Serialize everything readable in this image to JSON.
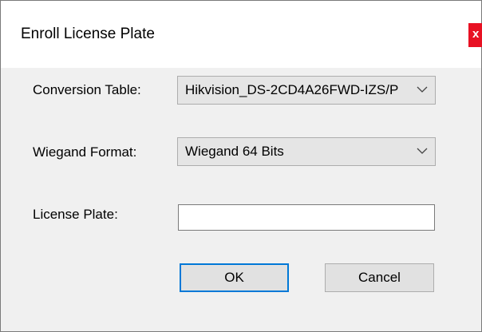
{
  "window": {
    "title": "Enroll License Plate",
    "close_glyph": "x",
    "close_icon": "close-icon"
  },
  "form": {
    "conversion_table": {
      "label": "Conversion Table:",
      "selected_value": "Hikvision_DS-2CD4A26FWD-IZS/P",
      "dropdown_icon": "chevron-down-icon"
    },
    "wiegand_format": {
      "label": "Wiegand Format:",
      "selected_value": "Wiegand 64 Bits",
      "dropdown_icon": "chevron-down-icon"
    },
    "license_plate": {
      "label": "License Plate:",
      "value": "",
      "placeholder": ""
    }
  },
  "buttons": {
    "ok_label": "OK",
    "cancel_label": "Cancel"
  },
  "colors": {
    "close_button": "#e81123",
    "default_button_border": "#0078d7",
    "dialog_background": "#f0f0f0"
  }
}
